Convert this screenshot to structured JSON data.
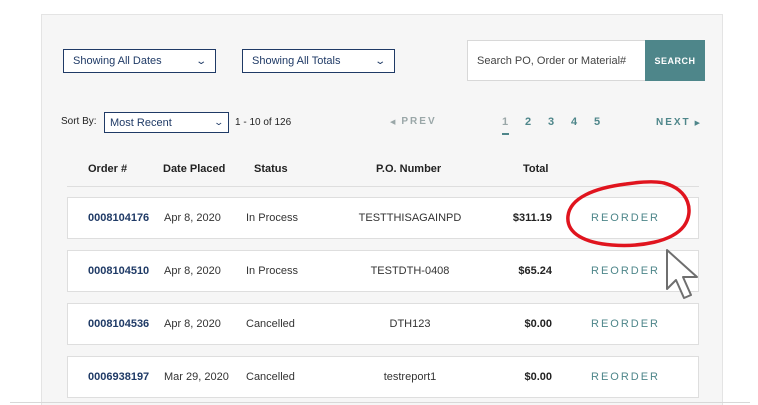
{
  "filters": {
    "dates": "Showing All Dates",
    "totals": "Showing All Totals"
  },
  "search": {
    "placeholder": "Search PO, Order or Material#",
    "button": "SEARCH"
  },
  "sort": {
    "label": "Sort By:",
    "value": "Most Recent",
    "range": "1 - 10 of 126"
  },
  "pagination": {
    "prev": "PREV",
    "next": "NEXT",
    "pages": [
      "1",
      "2",
      "3",
      "4",
      "5"
    ],
    "current": "1"
  },
  "table": {
    "headers": {
      "order": "Order #",
      "date": "Date Placed",
      "status": "Status",
      "po": "P.O. Number",
      "total": "Total"
    },
    "rows": [
      {
        "order": "0008104176",
        "date": "Apr 8, 2020",
        "status": "In Process",
        "po": "TESTTHISAGAINPD",
        "total": "$311.19",
        "action": "REORDER"
      },
      {
        "order": "0008104510",
        "date": "Apr 8, 2020",
        "status": "In Process",
        "po": "TESTDTH-0408",
        "total": "$65.24",
        "action": "REORDER"
      },
      {
        "order": "0008104536",
        "date": "Apr 8, 2020",
        "status": "Cancelled",
        "po": "DTH123",
        "total": "$0.00",
        "action": "REORDER"
      },
      {
        "order": "0006938197",
        "date": "Mar 29, 2020",
        "status": "Cancelled",
        "po": "testreport1",
        "total": "$0.00",
        "action": "REORDER"
      }
    ]
  },
  "annotation": {
    "circle_color": "#e0141e",
    "pointer_icon": "mouse-pointer-icon"
  },
  "colors": {
    "navy": "#1f3a66",
    "teal": "#4e868a"
  }
}
